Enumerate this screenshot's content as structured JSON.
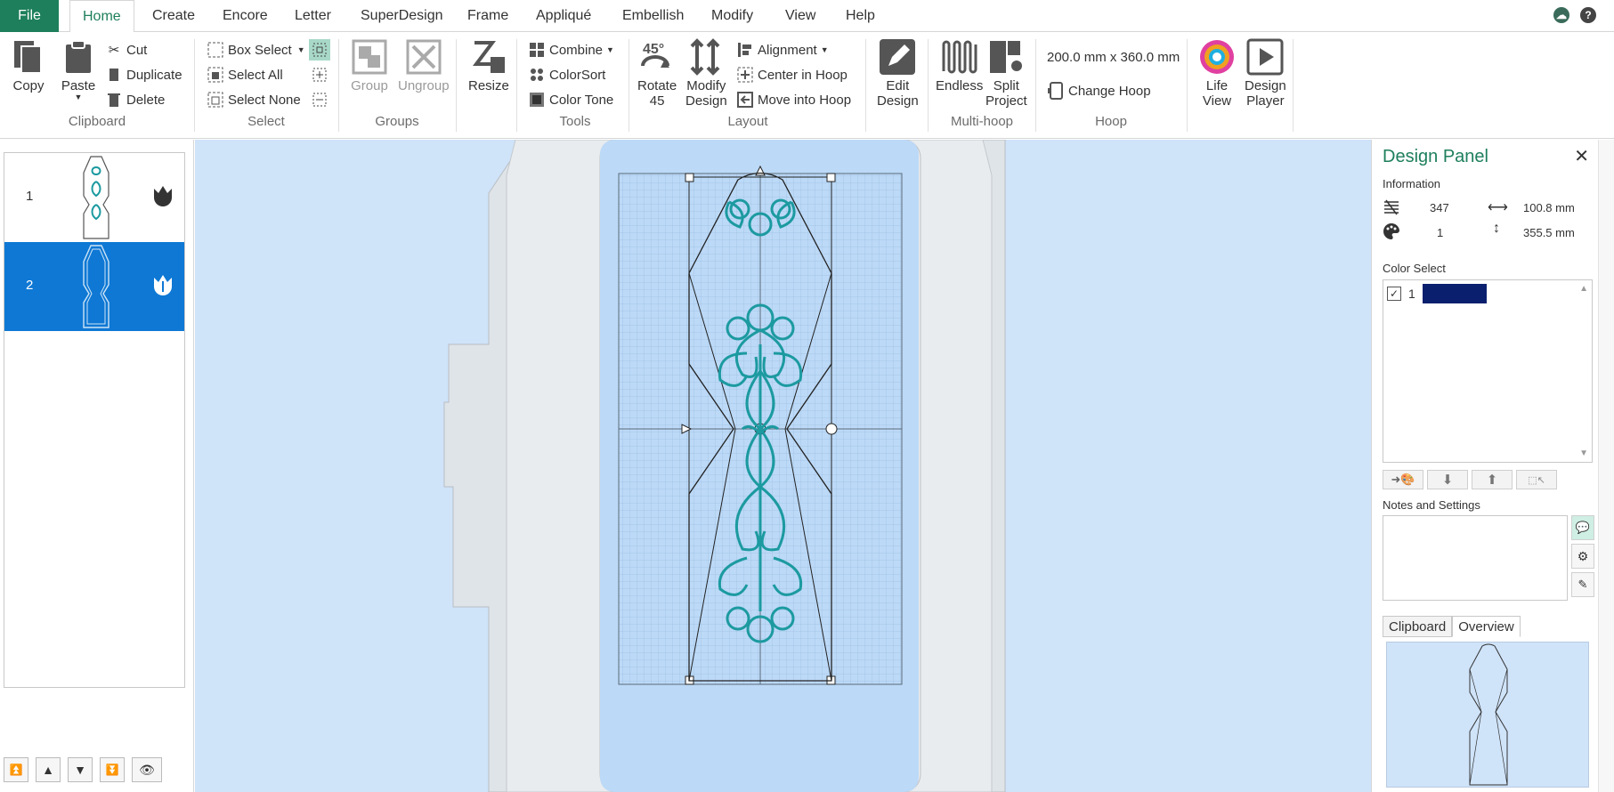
{
  "tabs": {
    "file": "File",
    "items": [
      "Home",
      "Create",
      "Encore",
      "Letter",
      "SuperDesign",
      "Frame",
      "Appliqué",
      "Embellish",
      "Modify",
      "View",
      "Help"
    ],
    "active": "Home"
  },
  "ribbon": {
    "clipboard": {
      "label": "Clipboard",
      "copy": "Copy",
      "paste": "Paste",
      "cut": "Cut",
      "duplicate": "Duplicate",
      "delete": "Delete"
    },
    "select": {
      "label": "Select",
      "box_select": "Box Select",
      "select_all": "Select All",
      "select_none": "Select None"
    },
    "groups": {
      "label": "Groups",
      "group": "Group",
      "ungroup": "Ungroup"
    },
    "resize": "Resize",
    "tools": {
      "label": "Tools",
      "combine": "Combine",
      "colorsort": "ColorSort",
      "color_tone": "Color Tone"
    },
    "layout": {
      "label": "Layout",
      "rotate_1": "Rotate",
      "rotate_2": "45",
      "modify_1": "Modify",
      "modify_2": "Design",
      "alignment": "Alignment",
      "center_in_hoop": "Center in Hoop",
      "move_into_hoop": "Move into Hoop"
    },
    "edit_1": "Edit",
    "edit_2": "Design",
    "multihoop": {
      "label": "Multi-hoop",
      "endless": "Endless",
      "split_1": "Split",
      "split_2": "Project"
    },
    "hoop": {
      "label": "Hoop",
      "size": "200.0 mm x 360.0 mm",
      "change_hoop": "Change Hoop"
    },
    "life_1": "Life",
    "life_2": "View",
    "player_1": "Design",
    "player_2": "Player"
  },
  "designs": [
    {
      "num": "1",
      "selected": false
    },
    {
      "num": "2",
      "selected": true
    }
  ],
  "panel": {
    "title": "Design Panel",
    "information_label": "Information",
    "stitches": "347",
    "width": "100.8 mm",
    "colors": "1",
    "height": "355.5 mm",
    "color_select_label": "Color Select",
    "color_items": [
      {
        "num": "1",
        "color": "#0a1f6e"
      }
    ],
    "notes_label": "Notes and Settings",
    "bottom_tabs": [
      "Clipboard",
      "Overview"
    ],
    "active_bottom_tab": "Overview"
  },
  "colors": {
    "accent": "#1e7f5c",
    "selection": "#0e78d4",
    "canvas_bg": "#cfe3f9",
    "hoop_area": "#bcd9f7",
    "stitch": "#1c9aa0",
    "outline": "#222222"
  }
}
